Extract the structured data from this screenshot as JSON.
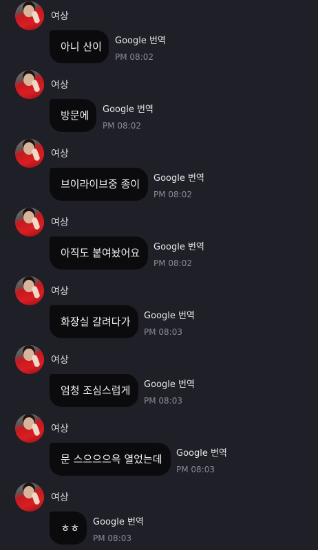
{
  "messages": [
    {
      "sender": "여상",
      "text": "아니 산이",
      "translate": "Google 번역",
      "time": "PM 08:02"
    },
    {
      "sender": "여상",
      "text": "방문에",
      "translate": "Google 번역",
      "time": "PM 08:02"
    },
    {
      "sender": "여상",
      "text": "브이라이브중 종이",
      "translate": "Google 번역",
      "time": "PM 08:02"
    },
    {
      "sender": "여상",
      "text": "아직도 붙여놨어요",
      "translate": "Google 번역",
      "time": "PM 08:02"
    },
    {
      "sender": "여상",
      "text": "화장실 갈려다가",
      "translate": "Google 번역",
      "time": "PM 08:03"
    },
    {
      "sender": "여상",
      "text": "엄청 조심스럽게",
      "translate": "Google 번역",
      "time": "PM 08:03"
    },
    {
      "sender": "여상",
      "text": "문 스으으으윽 열었는데",
      "translate": "Google 번역",
      "time": "PM 08:03"
    },
    {
      "sender": "여상",
      "text": "ㅎㅎ",
      "translate": "Google 번역",
      "time": "PM 08:03"
    }
  ]
}
